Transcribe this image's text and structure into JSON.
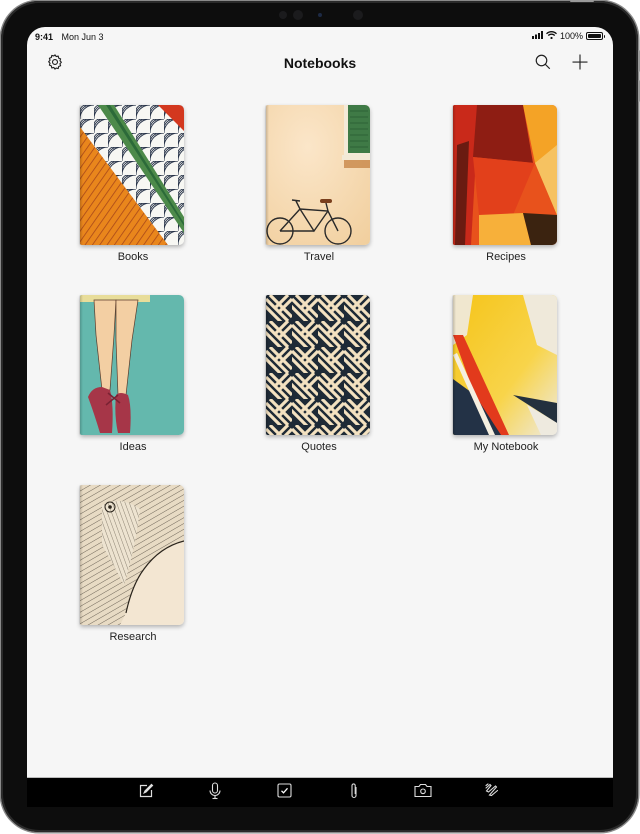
{
  "status_bar": {
    "time": "9:41",
    "date": "Mon Jun 3",
    "battery_text": "100%",
    "battery_level": 1.0,
    "icons": [
      "cellular-signal-icon",
      "wifi-icon",
      "battery-icon"
    ]
  },
  "nav": {
    "title": "Notebooks",
    "left_icon": "gear-icon",
    "right_icons": [
      "search-icon",
      "plus-icon"
    ]
  },
  "notebooks": [
    {
      "label": "Books",
      "cover": "orange-green-pattern"
    },
    {
      "label": "Travel",
      "cover": "bicycle-wall"
    },
    {
      "label": "Recipes",
      "cover": "red-orange-abstract"
    },
    {
      "label": "Ideas",
      "cover": "ballet-shoes"
    },
    {
      "label": "Quotes",
      "cover": "navy-cream-geometric"
    },
    {
      "label": "My Notebook",
      "cover": "yellow-red-brushstroke"
    },
    {
      "label": "Research",
      "cover": "elephant-sketch"
    }
  ],
  "toolbar": {
    "tools": [
      "compose-icon",
      "microphone-icon",
      "checklist-icon",
      "paperclip-icon",
      "camera-icon",
      "scribble-icon"
    ]
  },
  "colors": {
    "screen_bg": "#f6f6f6",
    "device_frame": "#0d0d0d",
    "toolbar_bg": "#000000",
    "text": "#111111"
  }
}
